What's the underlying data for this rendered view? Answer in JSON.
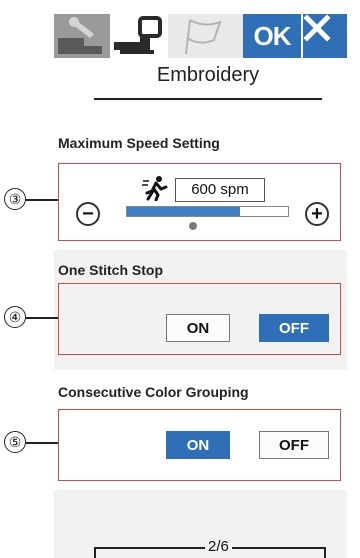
{
  "tabs": {
    "tools_icon": "wrench-icon",
    "sewing_icon": "sewing-machine-icon",
    "flag_icon": "flag-icon",
    "ok_label": "OK",
    "close_icon": "close-icon"
  },
  "page": {
    "title": "Embroidery",
    "indicator": "2/6"
  },
  "max_speed": {
    "title": "Maximum Speed Setting",
    "callout": "③",
    "value": "600 spm",
    "runner_icon": "running-man-icon",
    "minus_icon": "minus-icon",
    "plus_icon": "plus-icon",
    "minus_glyph": "−",
    "plus_glyph": "+",
    "level": 0.7
  },
  "one_stitch_stop": {
    "title": "One Stitch Stop",
    "callout": "④",
    "on_label": "ON",
    "off_label": "OFF",
    "selected": "OFF"
  },
  "color_grouping": {
    "title": "Consecutive Color Grouping",
    "callout": "⑤",
    "on_label": "ON",
    "off_label": "OFF",
    "selected": "ON"
  },
  "colors": {
    "accent": "#2f6fb6",
    "callout_box": "#d34a4a",
    "panel_bg": "#f2f2f2"
  }
}
